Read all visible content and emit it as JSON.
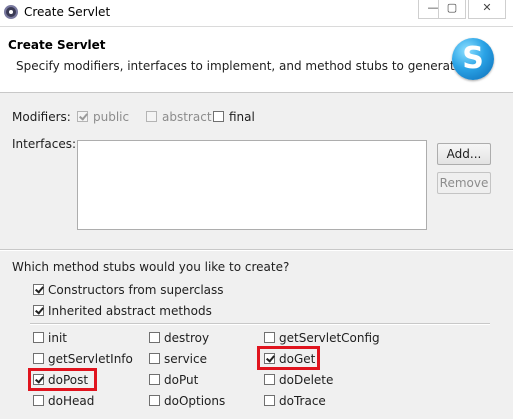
{
  "window": {
    "title": "Create Servlet",
    "controls": [
      "—",
      "▢",
      "✕"
    ]
  },
  "header": {
    "title": "Create Servlet",
    "description": "Specify modifiers, interfaces to implement, and method stubs to generate.",
    "logo_letter": "S"
  },
  "modifiers": {
    "label": "Modifiers:",
    "public": {
      "label": "public",
      "checked": true,
      "enabled": false
    },
    "abstract": {
      "label": "abstract",
      "checked": false,
      "enabled": false
    },
    "final": {
      "label": "final",
      "checked": false,
      "enabled": true
    }
  },
  "interfaces": {
    "label": "Interfaces:",
    "add_label": "Add...",
    "remove_label": "Remove",
    "items": []
  },
  "stubs": {
    "question": "Which method stubs would you like to create?",
    "constructors": {
      "label": "Constructors from superclass",
      "checked": true
    },
    "inherited": {
      "label": "Inherited abstract methods",
      "checked": true
    },
    "methods": [
      {
        "label": "init",
        "checked": false
      },
      {
        "label": "destroy",
        "checked": false
      },
      {
        "label": "getServletConfig",
        "checked": false
      },
      {
        "label": "getServletInfo",
        "checked": false
      },
      {
        "label": "service",
        "checked": false
      },
      {
        "label": "doGet",
        "checked": true
      },
      {
        "label": "doPost",
        "checked": true
      },
      {
        "label": "doPut",
        "checked": false
      },
      {
        "label": "doDelete",
        "checked": false
      },
      {
        "label": "doHead",
        "checked": false
      },
      {
        "label": "doOptions",
        "checked": false
      },
      {
        "label": "doTrace",
        "checked": false
      }
    ]
  },
  "colors": {
    "highlight": "#e0141e"
  }
}
